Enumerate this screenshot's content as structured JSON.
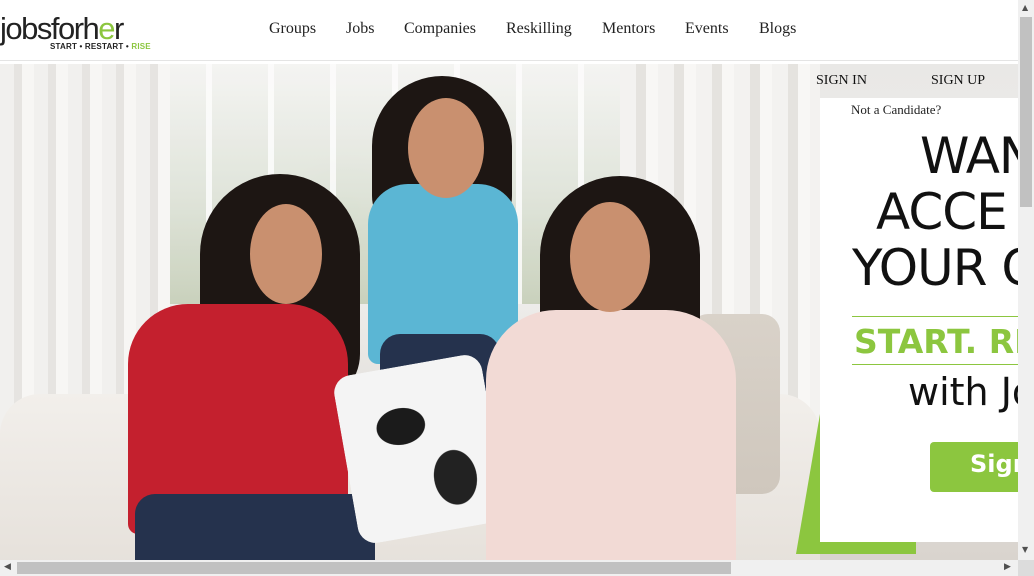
{
  "logo": {
    "part1": "jobsfor",
    "part2a": "h",
    "part2b": "e",
    "part2c": "r",
    "tagline_main": "START • RESTART • ",
    "tagline_accent": "RISE",
    "accent_color": "#8cc63f"
  },
  "nav": {
    "items": [
      "Groups",
      "Jobs",
      "Companies",
      "Reskilling",
      "Mentors",
      "Events",
      "Blogs"
    ]
  },
  "auth": {
    "sign_in": "SIGN IN",
    "sign_up": "SIGN UP"
  },
  "panel": {
    "not_candidate": "Not a Candidate?",
    "line1": "WAN",
    "line2": "ACCE",
    "line3": "YOUR C",
    "tagline": "START. RE",
    "with_line": "with Jo",
    "button_label": "Sign"
  },
  "hero": {
    "image_icon": "hero-photo"
  },
  "colors": {
    "brand_green": "#8cc63f",
    "text": "#111111"
  },
  "scrollbars": {
    "up_arrow": "▲",
    "down_arrow": "▼",
    "left_arrow": "◀",
    "right_arrow": "▶"
  }
}
